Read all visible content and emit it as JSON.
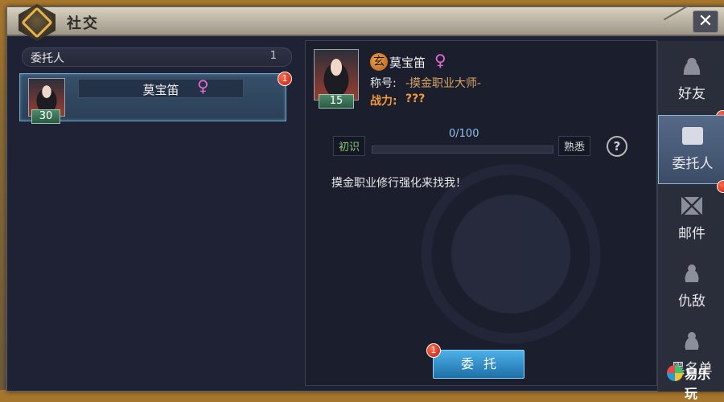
{
  "window": {
    "title": "社交",
    "close_label": "✕"
  },
  "list": {
    "header_label": "委托人",
    "header_count": "1",
    "items": [
      {
        "name": "莫宝笛",
        "gender": "♀",
        "level": "30",
        "badge": "1"
      }
    ]
  },
  "detail": {
    "name": "莫宝笛",
    "gender": "♀",
    "class_icon": "玄",
    "level": "15",
    "title_label": "称号:",
    "title_value": "-摸金职业大师-",
    "power_label": "战力:",
    "power_value": "???",
    "progress": {
      "left_label": "初识",
      "right_label": "熟悉",
      "text": "0/100",
      "value": 0,
      "max": 100
    },
    "help_label": "?",
    "message": "摸金职业修行强化来找我！",
    "button_label": "委托",
    "button_badge": "1"
  },
  "tabs": [
    {
      "label": "好友",
      "icon": "friends-icon",
      "active": false,
      "badge": true
    },
    {
      "label": "委托人",
      "icon": "client-card-icon",
      "active": true,
      "badge": true
    },
    {
      "label": "邮件",
      "icon": "mail-icon",
      "active": false,
      "badge": false
    },
    {
      "label": "仇敌",
      "icon": "enemy-icon",
      "active": false,
      "badge": false
    },
    {
      "label": "黑名单",
      "icon": "blacklist-icon",
      "active": false,
      "badge": false
    }
  ],
  "watermark": {
    "text": "易乐玩"
  },
  "colors": {
    "accent": "#8fd0ff",
    "frame": "#1f2234",
    "warning": "#f29a3a",
    "female": "#e46ad0"
  }
}
